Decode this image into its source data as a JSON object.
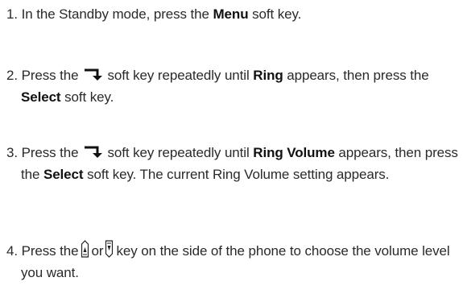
{
  "steps": [
    {
      "num": "1.",
      "t1": "In the Standby mode, press the",
      "b1": "Menu",
      "t2": "soft key."
    },
    {
      "num": "2.",
      "t1": "Press the",
      "icon1": "down-right-arrow-softkey-icon",
      "t2": "soft key repeatedly until",
      "b1": "Ring",
      "t3": "appears, then press the",
      "b2": "Select",
      "t4": "soft key."
    },
    {
      "num": "3.",
      "t1": "Press the",
      "icon1": "down-right-arrow-softkey-icon",
      "t2": "soft key repeatedly until",
      "b1": "Ring Volume",
      "t3": "appears, then press the",
      "b2": "Select",
      "t4": "soft key. The current Ring Volume setting appears."
    },
    {
      "num": "4.",
      "t1": "Press  the",
      "icon1": "volume-up-key-icon",
      "t2": "or",
      "icon2": "volume-down-key-icon",
      "t3": "key on the side of the phone to choose the volume level you want."
    }
  ]
}
